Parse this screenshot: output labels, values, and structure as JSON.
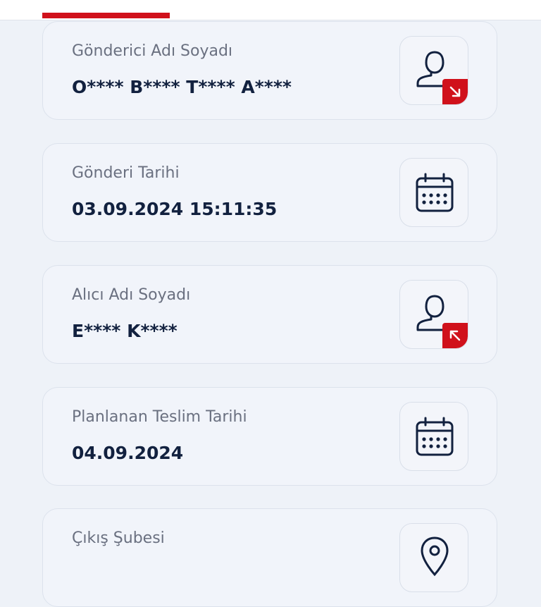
{
  "cards": [
    {
      "label": "Gönderici Adı Soyadı",
      "value": "O**** B**** T**** A****",
      "icon": "user-outgoing-icon"
    },
    {
      "label": "Gönderi Tarihi",
      "value": "03.09.2024 15:11:35",
      "icon": "calendar-icon"
    },
    {
      "label": "Alıcı Adı Soyadı",
      "value": "E**** K****",
      "icon": "user-incoming-icon"
    },
    {
      "label": "Planlanan Teslim Tarihi",
      "value": "04.09.2024",
      "icon": "calendar-icon"
    },
    {
      "label": "Çıkış Şubesi",
      "value": "",
      "icon": "location-icon"
    }
  ],
  "colors": {
    "accent": "#d0111b",
    "text_dark": "#12213f",
    "label_gray": "#6a7080",
    "card_bg": "#f1f4fa",
    "page_bg": "#eef2f8"
  }
}
